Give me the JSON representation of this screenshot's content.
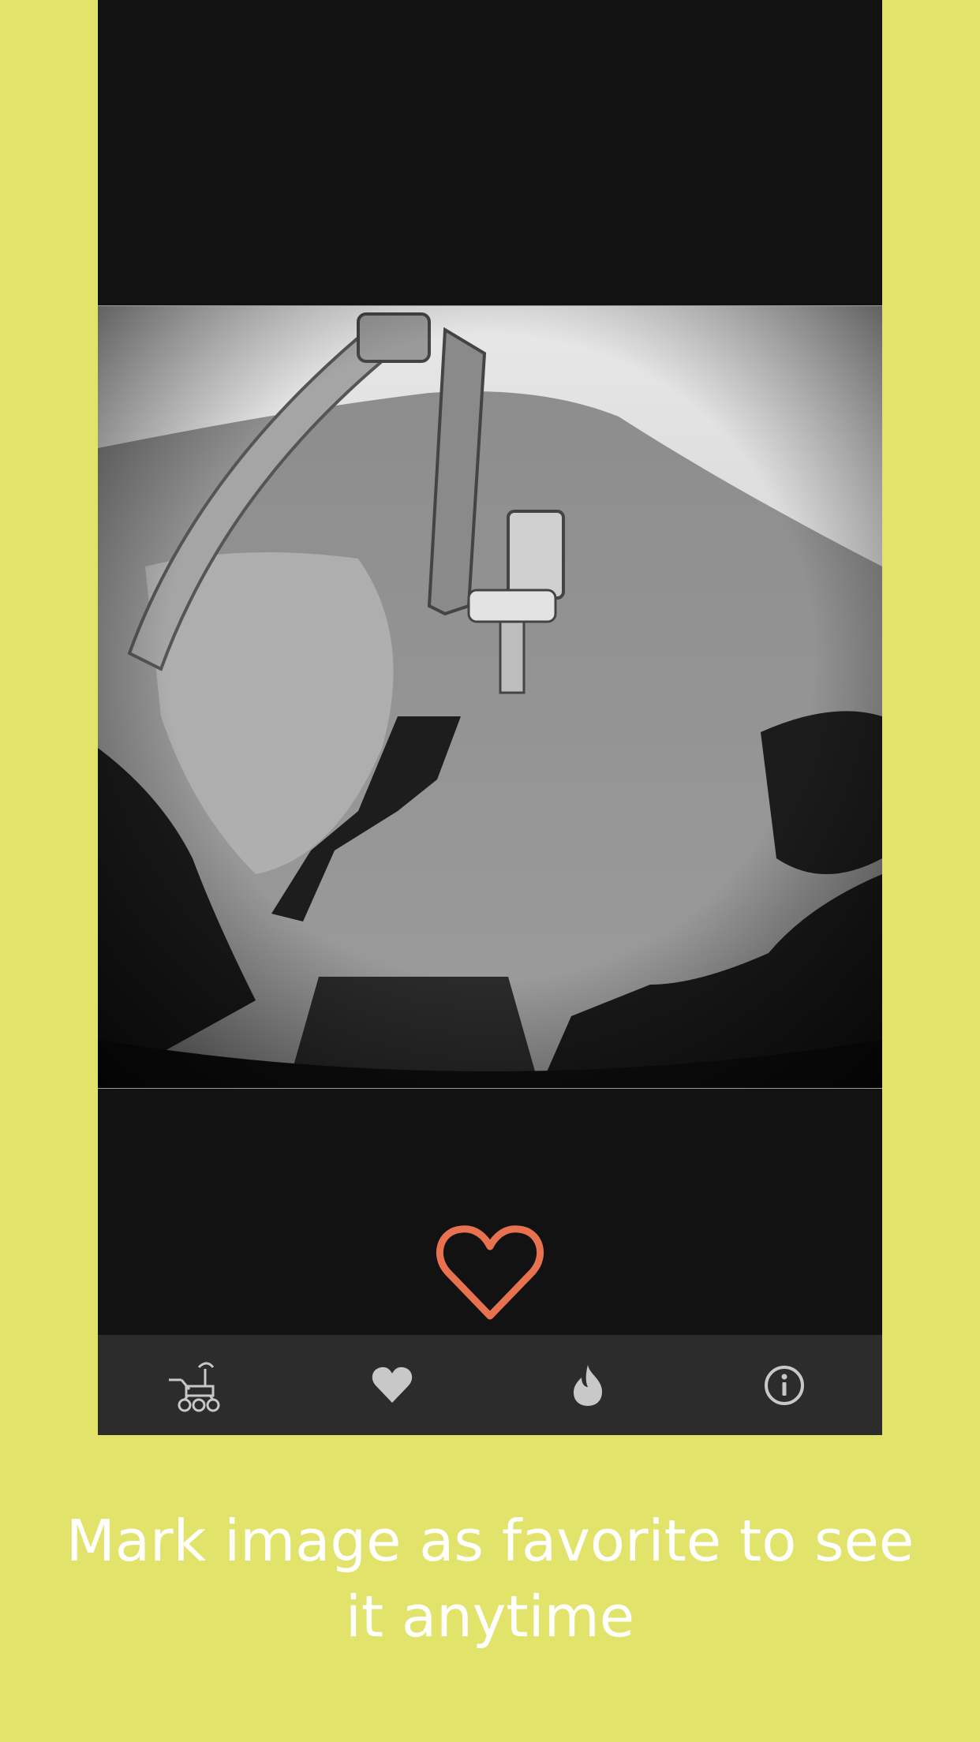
{
  "photo": {
    "description_icon": "mars-rover-hazcam-photo"
  },
  "favorite": {
    "icon": "heart-outline-icon",
    "color": "#e8714f"
  },
  "tabbar": {
    "background": "#2c2c2c",
    "icon_color": "#c8c8c8",
    "tabs": [
      {
        "icon": "rover-icon"
      },
      {
        "icon": "heart-icon"
      },
      {
        "icon": "flame-icon"
      },
      {
        "icon": "info-icon"
      }
    ]
  },
  "caption": {
    "text": "Mark image as favorite to see it anytime"
  },
  "colors": {
    "background": "#e2e36a",
    "screen": "#121212"
  }
}
